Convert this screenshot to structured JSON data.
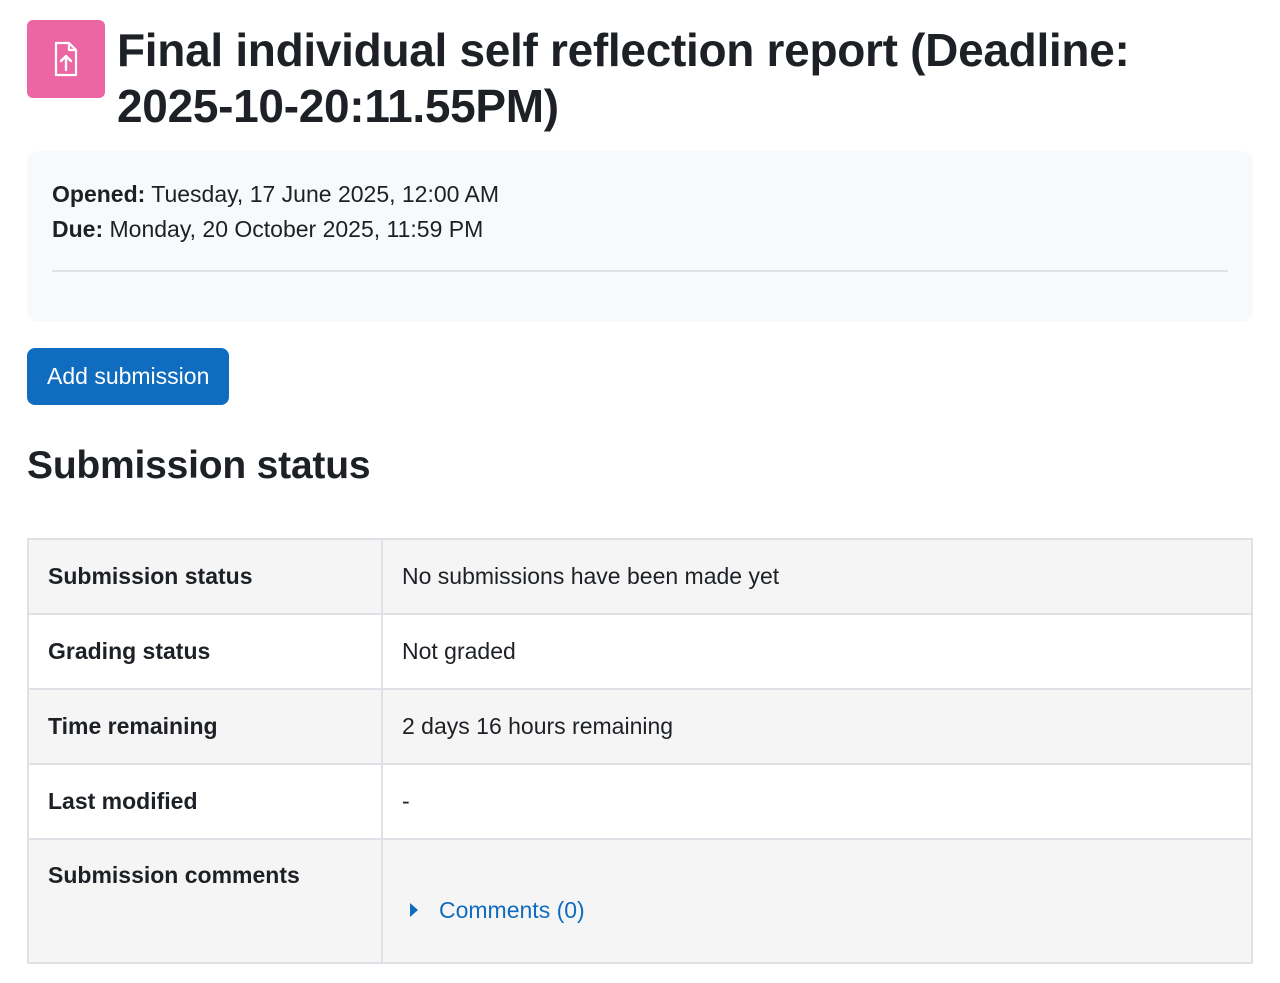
{
  "header": {
    "icon": "assignment-upload-icon",
    "icon_color": "#eb66a2",
    "title": "Final individual self reflection report (Deadline: 2025-10-20:11.55PM)"
  },
  "dates": {
    "opened_label": "Opened:",
    "opened_value": "Tuesday, 17 June 2025, 12:00 AM",
    "due_label": "Due:",
    "due_value": "Monday, 20 October 2025, 11:59 PM"
  },
  "actions": {
    "add_submission_label": "Add submission",
    "button_color": "#0f6cbf"
  },
  "submission_status": {
    "heading": "Submission status",
    "rows": [
      {
        "label": "Submission status",
        "value": "No submissions have been made yet"
      },
      {
        "label": "Grading status",
        "value": "Not graded"
      },
      {
        "label": "Time remaining",
        "value": "2 days 16 hours remaining"
      },
      {
        "label": "Last modified",
        "value": "-"
      },
      {
        "label": "Submission comments",
        "value": "Comments (0)"
      }
    ]
  }
}
